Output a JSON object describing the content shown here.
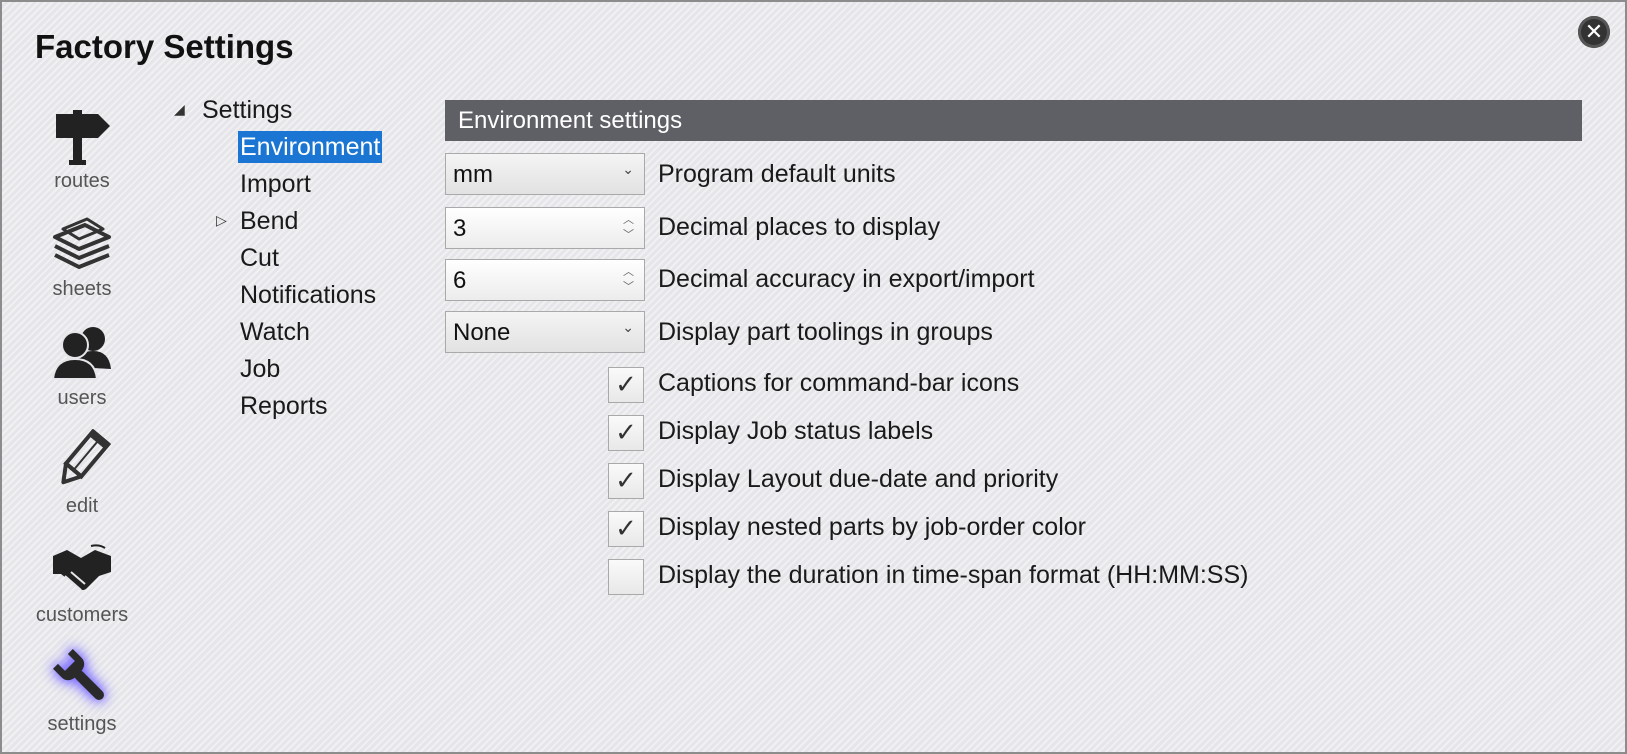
{
  "window": {
    "title": "Factory Settings",
    "close_icon": "close-icon"
  },
  "nav": {
    "items": [
      {
        "id": "routes",
        "label": "routes",
        "icon": "signpost-icon"
      },
      {
        "id": "sheets",
        "label": "sheets",
        "icon": "stacked-sheets-icon"
      },
      {
        "id": "users",
        "label": "users",
        "icon": "users-icon"
      },
      {
        "id": "edit",
        "label": "edit",
        "icon": "pencil-icon"
      },
      {
        "id": "customers",
        "label": "customers",
        "icon": "handshake-icon"
      },
      {
        "id": "settings",
        "label": "settings",
        "icon": "wrench-icon",
        "active": true
      }
    ]
  },
  "tree": {
    "root": "Settings",
    "children": [
      "Environment",
      "Import",
      "Bend",
      "Cut",
      "Notifications",
      "Watch",
      "Job",
      "Reports"
    ],
    "selected": "Environment"
  },
  "panel": {
    "header": "Environment settings",
    "rows": [
      {
        "control": "select",
        "value": "mm",
        "label": "Program default units"
      },
      {
        "control": "spin",
        "value": "3",
        "label": "Decimal places to display"
      },
      {
        "control": "spin",
        "value": "6",
        "label": "Decimal accuracy in export/import"
      },
      {
        "control": "select",
        "value": "None",
        "label": "Display part toolings in groups"
      }
    ],
    "checkboxes": [
      {
        "label": "Captions for command-bar icons",
        "checked": true
      },
      {
        "label": "Display Job status labels",
        "checked": true
      },
      {
        "label": "Display Layout due-date and priority",
        "checked": true
      },
      {
        "label": "Display nested parts by job-order color",
        "checked": true
      },
      {
        "label": "Display the duration in time-span format (HH:MM:SS)",
        "checked": false
      }
    ]
  },
  "colors": {
    "header_bg": "#5f6066",
    "selection": "#1a76d2",
    "glow": "#7060ff"
  }
}
